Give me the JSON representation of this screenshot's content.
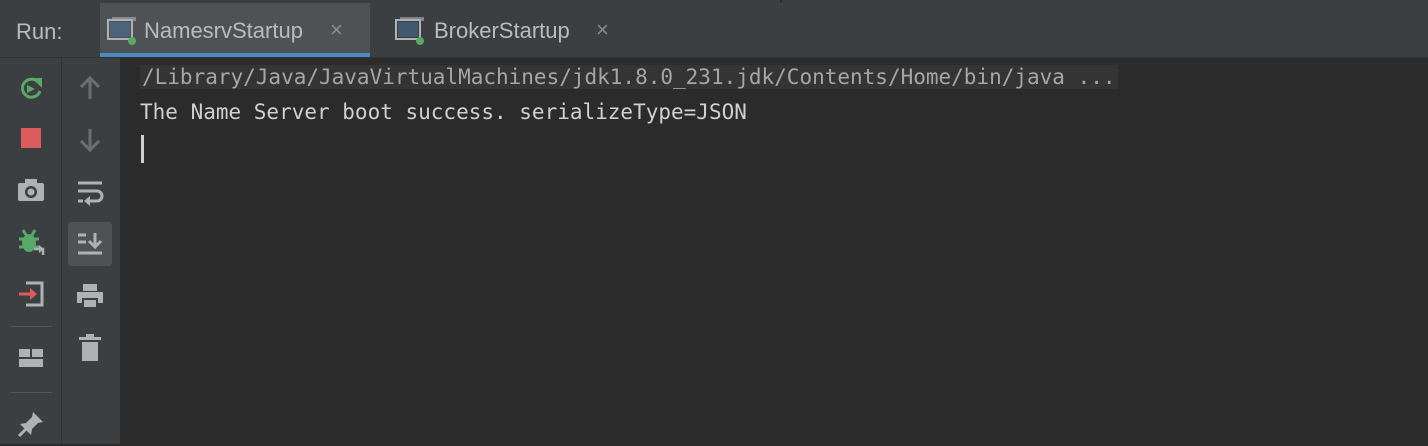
{
  "toolwindow": {
    "run_label": "Run:",
    "tabs": [
      {
        "label": "NamesrvStartup",
        "active": true
      },
      {
        "label": "BrokerStartup",
        "active": false
      }
    ],
    "tab_close_glyph": "×"
  },
  "left_toolbar": {
    "items": [
      "rerun-icon",
      "stop-icon",
      "camera-icon",
      "debug-bug-icon",
      "import-login-icon",
      "layout-icon",
      "pin-icon"
    ]
  },
  "secondary_toolbar": {
    "items": [
      "arrow-up-icon",
      "arrow-down-icon",
      "soft-wrap-icon",
      "scroll-to-end-icon",
      "print-icon",
      "trash-icon"
    ],
    "selected": "scroll-to-end-icon"
  },
  "console": {
    "lines": [
      "/Library/Java/JavaVirtualMachines/jdk1.8.0_231.jdk/Contents/Home/bin/java ...",
      "The Name Server boot success. serializeType=JSON"
    ]
  },
  "colors": {
    "panel": "#3c3f41",
    "editor": "#2b2b2b",
    "accent": "#4a88c7",
    "green": "#59a869",
    "red": "#db5c5c",
    "icon_gray": "#afb1b3"
  }
}
